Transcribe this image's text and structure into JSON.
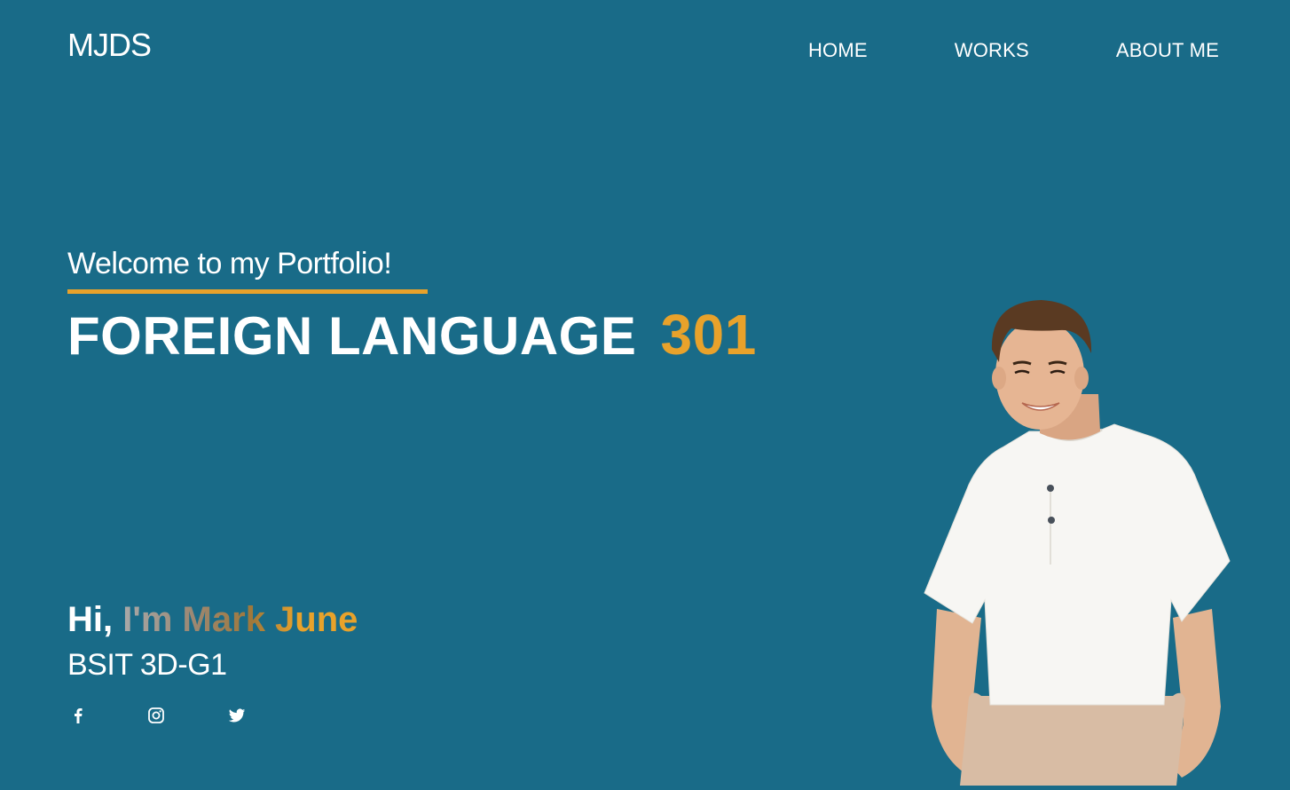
{
  "header": {
    "logo": "MJDS",
    "nav": [
      "HOME",
      "WORKS",
      "ABOUT ME"
    ]
  },
  "hero": {
    "welcome": "Welcome to my Portfolio!",
    "title_main": "FOREIGN LANGUAGE",
    "title_num": "301",
    "greeting": "Hi,",
    "name": "I'm Mark June",
    "course": "BSIT 3D-G1"
  },
  "socials": [
    "facebook-icon",
    "instagram-icon",
    "twitter-icon"
  ],
  "colors": {
    "background": "#196b88",
    "accent": "#e8a22b",
    "text": "#ffffff"
  }
}
